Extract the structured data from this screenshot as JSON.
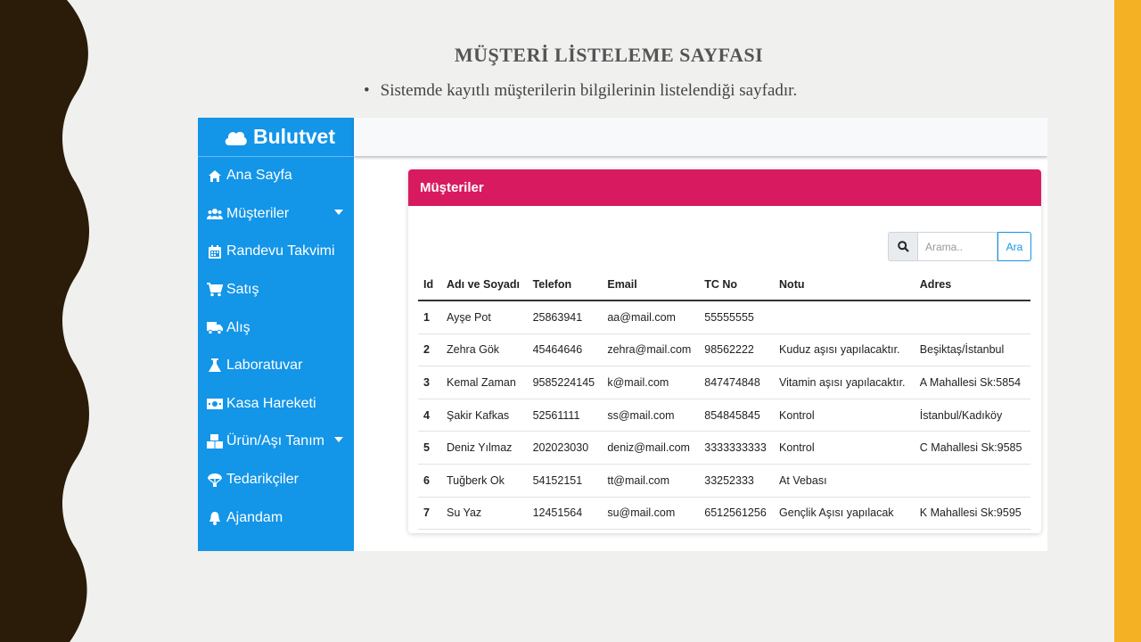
{
  "slide": {
    "title": "MÜŞTERİ LİSTELEME SAYFASI",
    "bullet": "Sistemde kayıtlı müşterilerin bilgilerinin listelendiği sayfadır."
  },
  "colors": {
    "sidebar": "#1395e8",
    "card_header": "#d81b60",
    "right_bar": "#f4b124",
    "wave": "#2a1c08"
  },
  "app": {
    "brand": "Bulutvet",
    "nav": [
      {
        "label": "Ana Sayfa",
        "icon": "home-icon"
      },
      {
        "label": "Müşteriler",
        "icon": "users-icon",
        "has_caret": true
      },
      {
        "label": "Randevu Takvimi",
        "icon": "calendar-icon"
      },
      {
        "label": "Satış",
        "icon": "cart-icon"
      },
      {
        "label": "Alış",
        "icon": "truck-icon"
      },
      {
        "label": "Laboratuvar",
        "icon": "flask-icon"
      },
      {
        "label": "Kasa Hareketi",
        "icon": "money-icon"
      },
      {
        "label": "Ürün/Aşı Tanım",
        "icon": "boxes-icon",
        "has_caret": true
      },
      {
        "label": "Tedarikçiler",
        "icon": "parachute-icon"
      },
      {
        "label": "Ajandam",
        "icon": "bell-icon"
      }
    ],
    "card": {
      "title": "Müşteriler",
      "search": {
        "placeholder": "Arama..",
        "button": "Ara"
      },
      "columns": [
        "Id",
        "Adı ve Soyadı",
        "Telefon",
        "Email",
        "TC No",
        "Notu",
        "Adres"
      ],
      "rows": [
        [
          "1",
          "Ayşe Pot",
          "25863941",
          "aa@mail.com",
          "55555555",
          "",
          ""
        ],
        [
          "2",
          "Zehra Gök",
          "45464646",
          "zehra@mail.com",
          "98562222",
          "Kuduz aşısı yapılacaktır.",
          "Beşiktaş/İstanbul"
        ],
        [
          "3",
          "Kemal Zaman",
          "9585224145",
          "k@mail.com",
          "847474848",
          "Vitamin aşısı yapılacaktır.",
          "A Mahallesi Sk:5854"
        ],
        [
          "4",
          "Şakir Kafkas",
          "52561111",
          "ss@mail.com",
          "854845845",
          "Kontrol",
          "İstanbul/Kadıköy"
        ],
        [
          "5",
          "Deniz Yılmaz",
          "202023030",
          "deniz@mail.com",
          "3333333333",
          "Kontrol",
          "C Mahallesi Sk:9585"
        ],
        [
          "6",
          "Tuğberk Ok",
          "54152151",
          "tt@mail.com",
          "33252333",
          "At Vebası",
          ""
        ],
        [
          "7",
          "Su Yaz",
          "12451564",
          "su@mail.com",
          "6512561256",
          "Gençlik Aşısı yapılacak",
          "K Mahallesi Sk:9595"
        ]
      ]
    }
  }
}
